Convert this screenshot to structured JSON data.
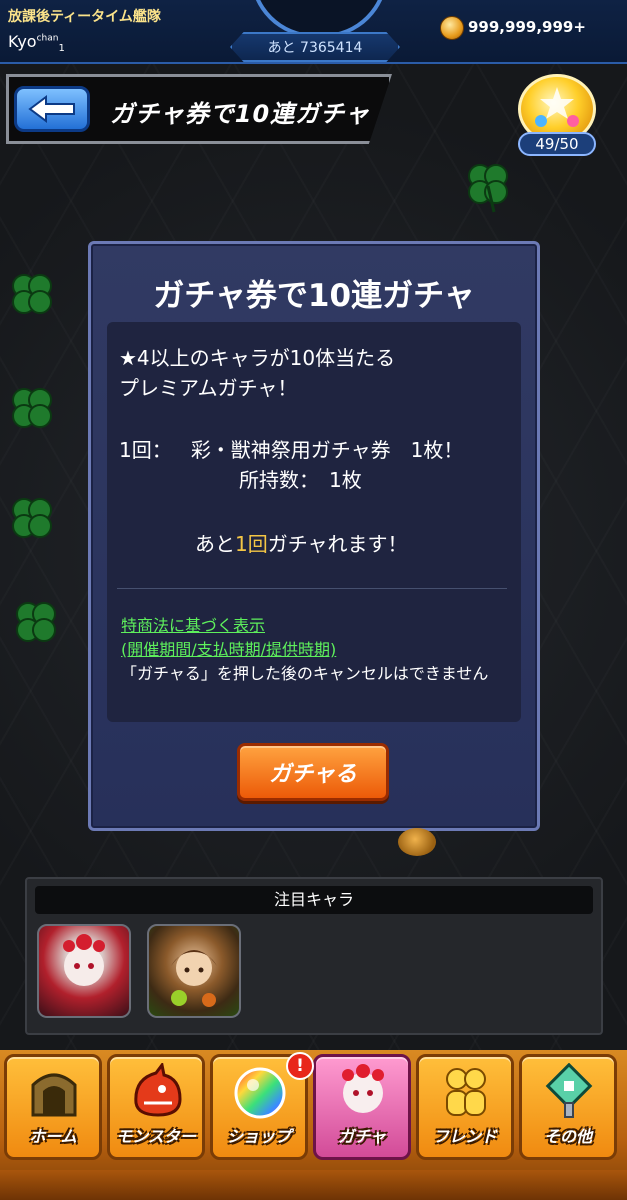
{
  "header": {
    "team_name": "放課後ティータイム艦隊",
    "player_name": "Kyo",
    "player_name_suffix": "chan",
    "player_name_index": "1",
    "xp_remaining": "あと 7365414",
    "coin_amount": "999,999,999+",
    "coin_icon": "coin-icon"
  },
  "title_bar": {
    "back_icon": "back-arrow-icon",
    "title": "ガチャ券で10連ガチャ"
  },
  "orb_counter": {
    "value": "49/50",
    "icon": "orb-icon"
  },
  "dialog": {
    "title": "ガチャ券で10連ガチャ",
    "line1": "★4以上のキャラが10体当たる",
    "line2": "プレミアムガチャ！",
    "cost_label": "1回：",
    "cost_item": "彩・獣神祭用ガチャ券　1枚！",
    "owned": "所持数：　1枚",
    "remaining_prefix": "あと",
    "remaining_count": "1回",
    "remaining_suffix": "ガチャれます！",
    "legal_link1": "特商法に基づく表示",
    "legal_link2": "(開催期間/支払時期/提供時期)",
    "legal_note": "「ガチャる」を押した後のキャンセルはできません",
    "gacha_button": "ガチャる"
  },
  "featured": {
    "header": "注目キャラ",
    "characters": [
      {
        "icon": "character-portrait-white-hair"
      },
      {
        "icon": "character-portrait-brown-hair"
      }
    ]
  },
  "nav": {
    "items": [
      {
        "label": "ホーム",
        "icon": "home-gate-icon"
      },
      {
        "label": "モンスター",
        "icon": "monster-icon"
      },
      {
        "label": "ショップ",
        "icon": "rainbow-orb-icon"
      },
      {
        "label": "ガチャ",
        "icon": "gacha-icon",
        "active": true
      },
      {
        "label": "フレンド",
        "icon": "friend-icon"
      },
      {
        "label": "その他",
        "icon": "other-icon"
      }
    ],
    "shop_badge": "!"
  },
  "colors": {
    "accent_blue": "#3c78c8",
    "gold_highlight": "#f4c645",
    "legal_green": "#5ef05c",
    "button_orange": "#ec5a08",
    "active_tab_pink": "#d24b98"
  }
}
